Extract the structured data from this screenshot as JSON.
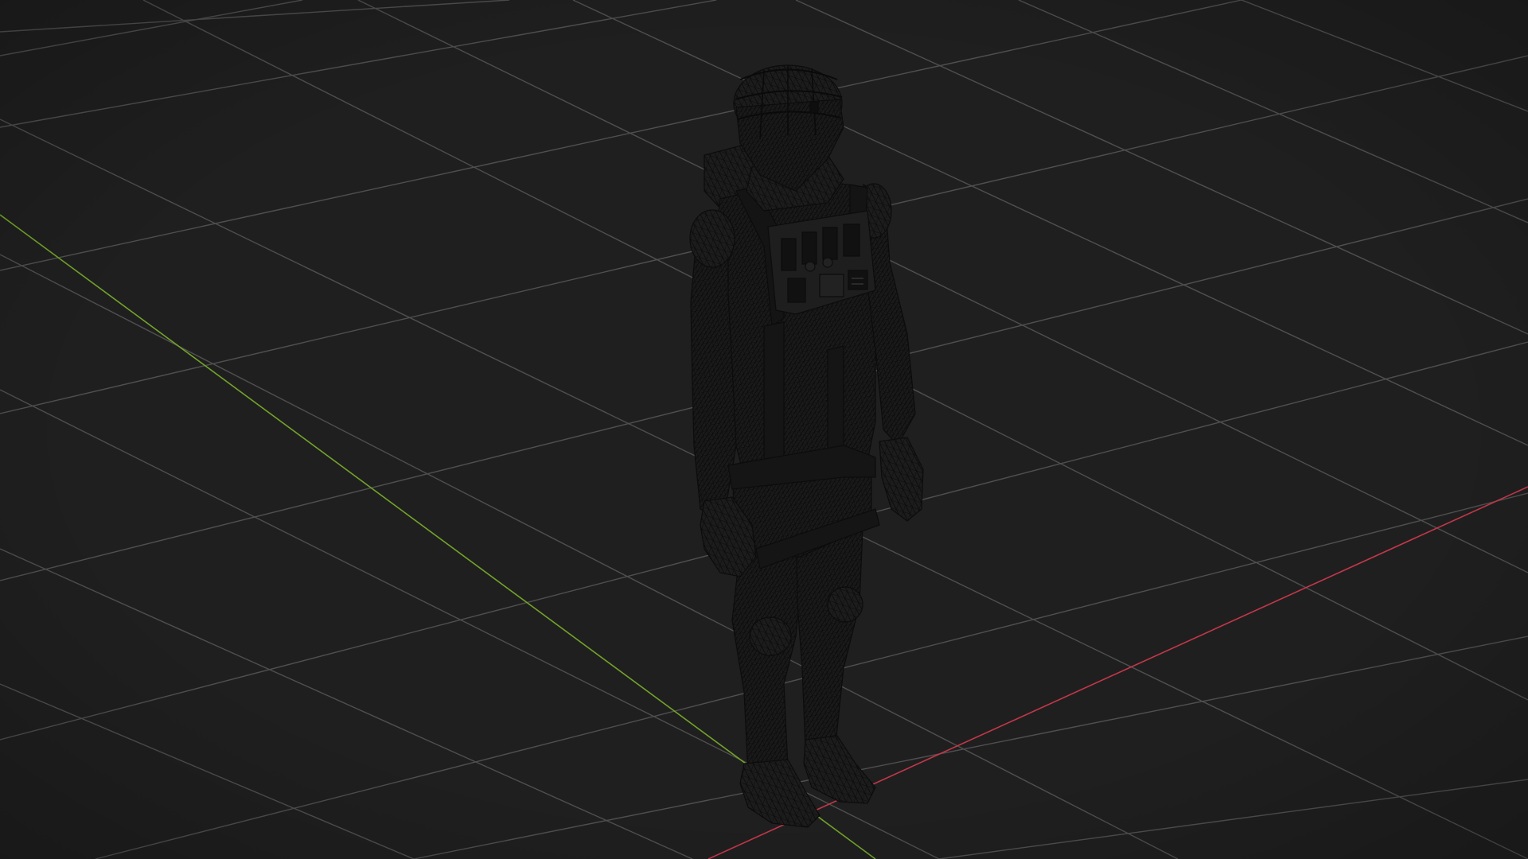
{
  "viewport": {
    "background": "#1f1f1f",
    "grid_color": "#555555",
    "x_axis_color": "#c4374a",
    "y_axis_color": "#72a32a",
    "mesh_fill": "#1c1c1c",
    "wire_color": "#0d0d0d",
    "object_name": "astronaut-wireframe-model",
    "view_shading": "wireframe"
  }
}
